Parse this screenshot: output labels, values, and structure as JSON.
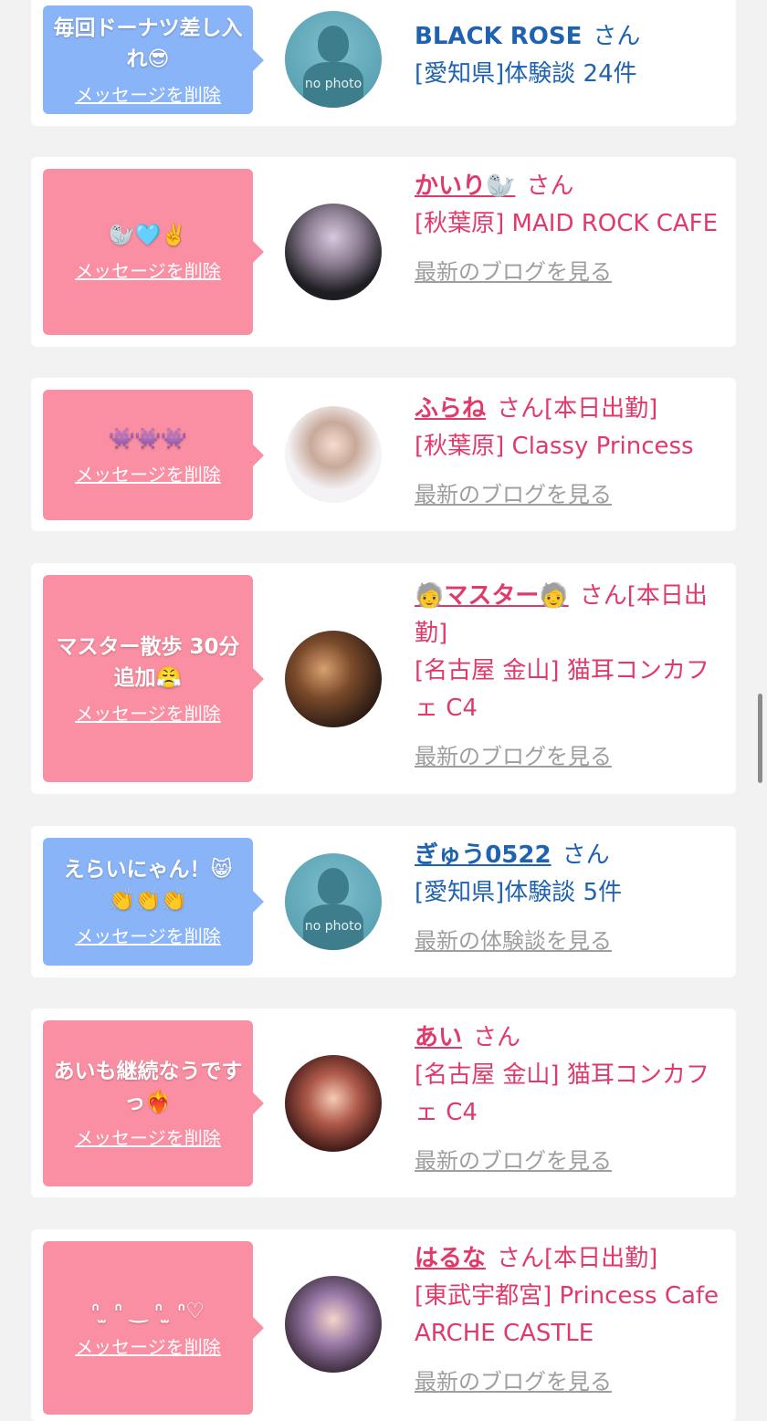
{
  "delete_label": "メッセージを削除",
  "san": "さん",
  "nophoto_label": "no photo",
  "entries": [
    {
      "message": "毎回ドーナツ差し入れ😎",
      "name": "BLACK ROSE",
      "shoutin": "",
      "shop": "[愛知県]体験談 24件",
      "link": ""
    },
    {
      "message": "🦭🩵✌️",
      "name": "かいり🦭",
      "shoutin": "",
      "shop": "[秋葉原] MAID ROCK CAFE",
      "link": "最新のブログを見る"
    },
    {
      "message": "👾👾👾",
      "name": "ふらね",
      "shoutin": "[本日出勤]",
      "shop": "[秋葉原] Classy Princess",
      "link": "最新のブログを見る"
    },
    {
      "message": "マスター散歩 30分追加😤",
      "name": "🧓マスター🧓",
      "shoutin": "[本日出勤]",
      "shop": "[名古屋 金山] 猫耳コンカフェ C4",
      "link": "最新のブログを見る"
    },
    {
      "message": "えらいにゃん！😸👏👏👏",
      "name": "ぎゅう0522",
      "shoutin": "",
      "shop": "[愛知県]体験談 5件",
      "link": "最新の体験談を見る"
    },
    {
      "message": "あいも継続なうですっ❤️‍🔥",
      "name": "あい",
      "shoutin": "",
      "shop": "[名古屋 金山] 猫耳コンカフェ C4",
      "link": "最新のブログを見る"
    },
    {
      "message": "ᐢ ̫ ᐢ ‿ ᐢ ̫ ᐢ♡",
      "name": "はるな",
      "shoutin": "[本日出勤]",
      "shop": "[東武宇都宮] Princess Cafe ARCHE CASTLE",
      "link": "最新のブログを見る"
    }
  ]
}
